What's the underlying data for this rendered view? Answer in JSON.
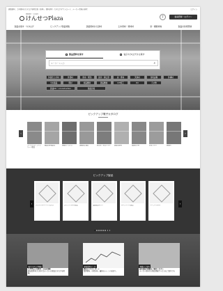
{
  "header": {
    "note": "建築建材、土木資材のカタログ検索比較（無料）。資料請求・カタログダウンロード、メーカー情報の検索",
    "top_link": "ログイン",
    "logo_sub": "建築建材・土木資材",
    "logo_main": "けんせつPlaza",
    "icon_label": "T",
    "register_button": "会員登録・ログイン"
  },
  "nav": {
    "items": [
      "製品を探す・カタログ",
      "ピックアップ製品特集",
      "建築資材から建材",
      "土木資材・資材材",
      "新・機能材等",
      "製品の新規登録"
    ]
  },
  "search": {
    "tab_product": "製品資料を探す",
    "tab_catalog": "電子カタログから探す",
    "placeholder": "キーワード入力"
  },
  "chips": [
    {
      "label": "外装仕上げ材"
    },
    {
      "label": "外部材"
    },
    {
      "label": "防水・断熱"
    },
    {
      "label": "建具・開口部"
    },
    {
      "label": "床・壁材"
    },
    {
      "label": "天井材"
    },
    {
      "label": "住宅設備"
    },
    {
      "label": "外構材"
    },
    {
      "label": "土木製品"
    },
    {
      "label": "資材"
    },
    {
      "label": "仮設機材"
    },
    {
      "label": "建設機械"
    },
    {
      "label": "ICT施工"
    },
    {
      "label": "DX"
    },
    {
      "label": "その他"
    },
    {
      "label": "建設DX・i-Construction",
      "wide": true
    },
    {
      "label": "製品比較",
      "wide": true
    }
  ],
  "pickup_catalog": {
    "title": "ピックアップ電子カタログ",
    "items": [
      {
        "name": "プレキャストコンクリート製品"
      },
      {
        "name": "橋梁用伸縮装置"
      },
      {
        "name": "床暖房システム"
      },
      {
        "name": "落橋防止構造"
      },
      {
        "name": "遮音壁・防音パネル"
      },
      {
        "name": "建築用鋼材"
      },
      {
        "name": "路面標示材"
      },
      {
        "name": "外壁パネル"
      },
      {
        "name": "屋根材"
      }
    ]
  },
  "pickup_products": {
    "title": "ピックアップ製品",
    "items": [
      {
        "name": "デザインルーバーシステム"
      },
      {
        "name": "スリットパネル製品"
      },
      {
        "name": "法面保護ネット"
      },
      {
        "name": "ルーフドレン製品"
      },
      {
        "name": "ソーラーパネル"
      }
    ],
    "pagination_count": 8,
    "active_index": 0
  },
  "banners": [
    {
      "label": "電子カタログ掲載",
      "title": "1,000以上の建材・工法を掲載",
      "text": "建設業界向けに様々なメーカーの製品カタログを掲載。"
    },
    {
      "label": "建設業界データ",
      "title": "建設ビジネスレポート",
      "text": "業界動向、市場分析、最新のトレンドを紹介。"
    },
    {
      "label": "掲載のご案内",
      "title": "自社製品の掲載をご検討ください",
      "text": "メーカー様向けの製品掲載サービスのご案内です。"
    }
  ],
  "colors": {
    "dark": "#343434",
    "chip": "#2e2e2e",
    "page_bg": "#e9e9e9"
  }
}
